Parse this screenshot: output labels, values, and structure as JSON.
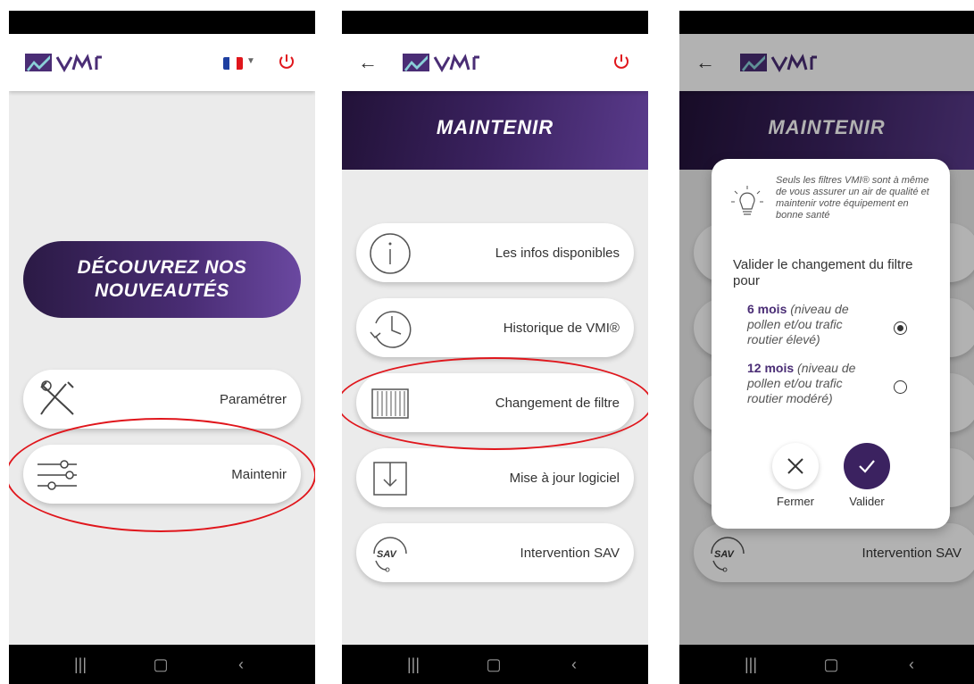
{
  "screen1": {
    "discover_line1": "DÉCOUVREZ NOS",
    "discover_line2": "NOUVEAUTÉS",
    "menu": [
      {
        "label": "Paramétrer",
        "icon": "tools-icon"
      },
      {
        "label": "Maintenir",
        "icon": "sliders-icon"
      }
    ]
  },
  "screen2": {
    "banner_title": "MAINTENIR",
    "menu": [
      {
        "label": "Les infos disponibles",
        "icon": "info-icon"
      },
      {
        "label": "Historique de VMI®",
        "icon": "history-icon"
      },
      {
        "label": "Changement de filtre",
        "icon": "filter-icon"
      },
      {
        "label": "Mise à jour logiciel",
        "icon": "download-icon"
      },
      {
        "label": "Intervention SAV",
        "icon": "sav-headset-icon"
      }
    ]
  },
  "screen3": {
    "banner_title": "MAINTENIR",
    "background_card_label": "Intervention SAV",
    "dialog": {
      "note": "Seuls les filtres VMI® sont à même de vous assurer un air de qualité et maintenir votre équipement en bonne santé",
      "question": "Valider le changement du filtre pour",
      "options": [
        {
          "bold": "6 mois",
          "detail": "(niveau de pollen et/ou trafic routier élevé)",
          "selected": true
        },
        {
          "bold": "12 mois",
          "detail": "(niveau de pollen et/ou trafic routier modéré)",
          "selected": false
        }
      ],
      "cancel_label": "Fermer",
      "confirm_label": "Valider"
    }
  },
  "colors": {
    "brand_purple": "#4a2d75",
    "brand_dark": "#221238",
    "highlight_red": "#e0161c",
    "power_red": "#e0161c"
  }
}
